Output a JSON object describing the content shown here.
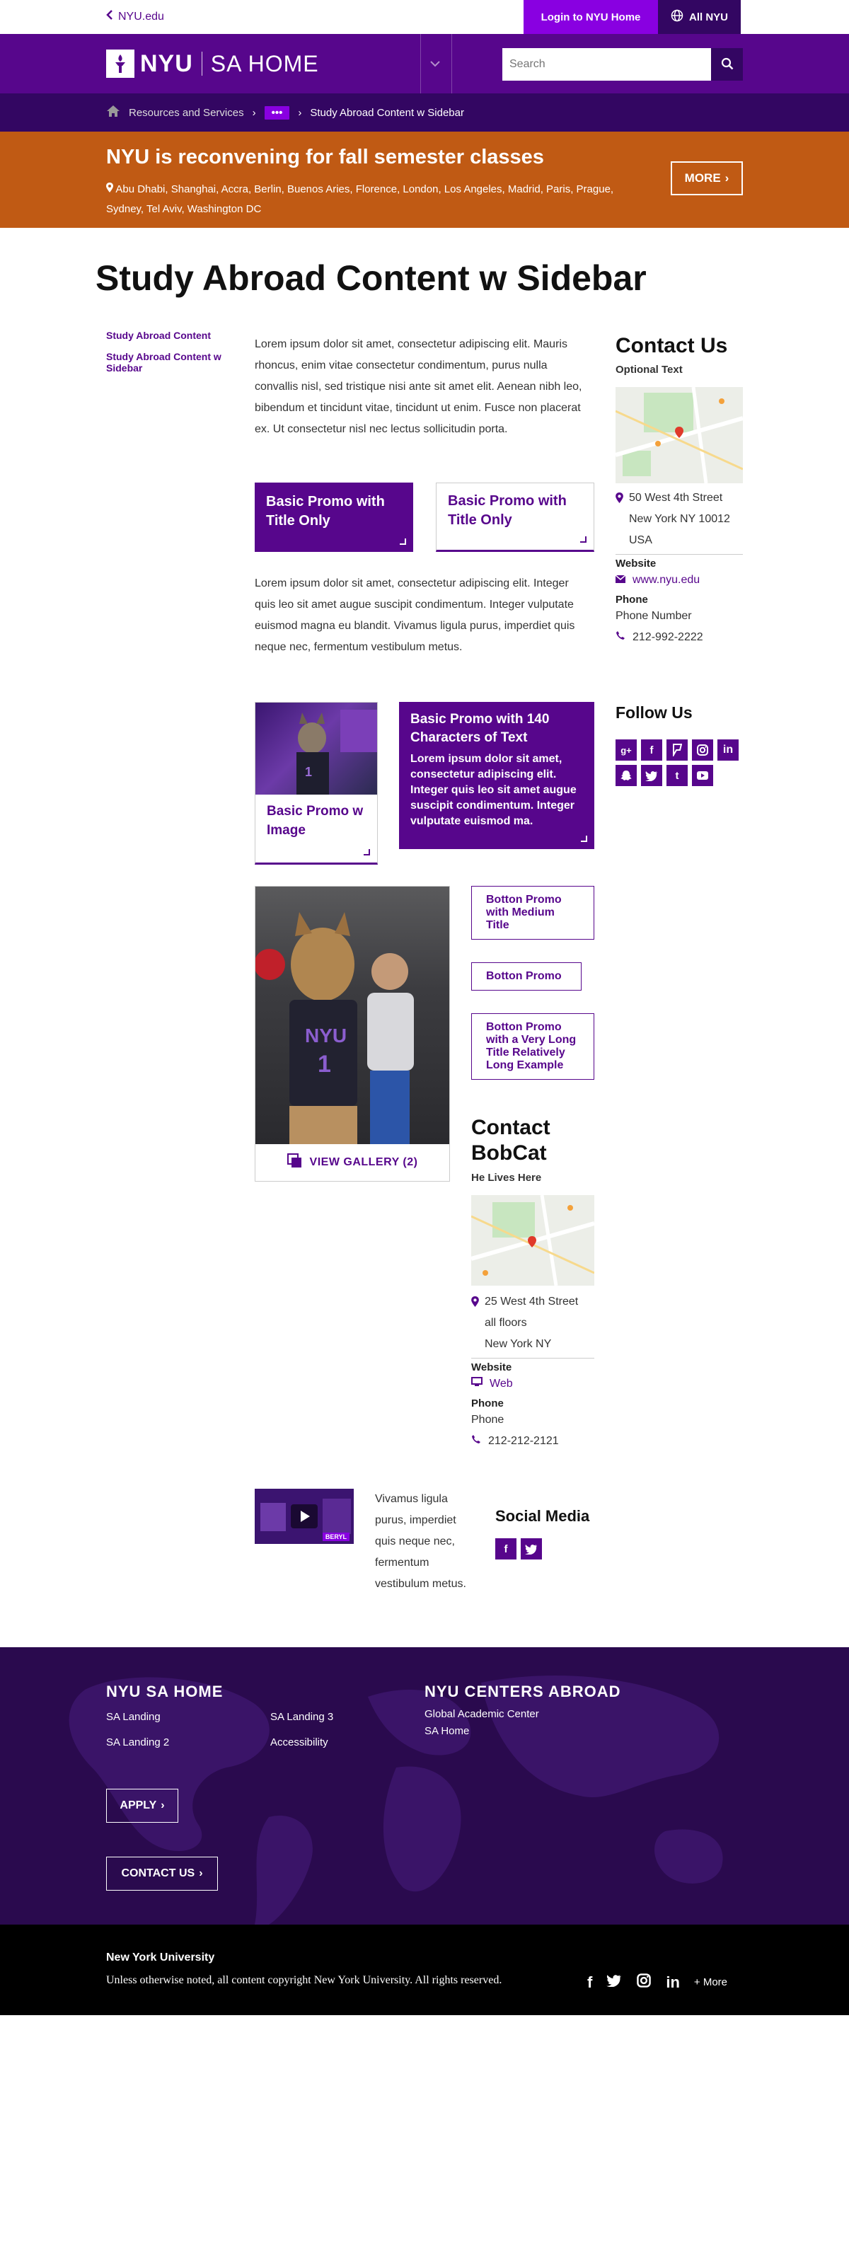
{
  "util": {
    "back_label": "NYU.edu",
    "login_label": "Login to NYU Home",
    "allnyu_label": "All NYU"
  },
  "header": {
    "logo_nyu": "NYU",
    "logo_site": "SA HOME",
    "search_placeholder": "Search"
  },
  "breadcrumb": {
    "item1": "Resources and Services",
    "more": "•••",
    "current": "Study Abroad Content w Sidebar"
  },
  "alert": {
    "title": "NYU is reconvening for fall semester classes",
    "locations": "Abu Dhabi, Shanghai, Accra, Berlin, Buenos Aries, Florence, London, Los Angeles, Madrid, Paris, Prague, Sydney, Tel Aviv, Washington DC",
    "more_label": "MORE"
  },
  "page": {
    "title": "Study Abroad Content w Sidebar"
  },
  "left_nav": [
    "Study Abroad Content",
    "Study Abroad Content w Sidebar"
  ],
  "main": {
    "para1": "Lorem ipsum dolor sit amet, consectetur adipiscing elit. Mauris rhoncus, enim vitae consectetur condimentum, purus nulla convallis nisl, sed tristique nisi ante sit amet elit. Aenean nibh leo, bibendum et tincidunt vitae, tincidunt ut enim. Fusce non placerat ex. Ut consectetur nisl nec lectus sollicitudin porta.",
    "promo_solid_title": "Basic Promo with Title Only",
    "promo_line_title": "Basic Promo with Title Only",
    "para2": "Lorem ipsum dolor sit amet, consectetur adipiscing elit. Integer quis leo sit amet augue suscipit condimentum. Integer vulputate euismod magna eu blandit. Vivamus ligula purus, imperdiet quis neque nec, fermentum vestibulum metus.",
    "promo_image_title": "Basic Promo w Image",
    "promo_140_title": "Basic Promo with 140 Characters of Text",
    "promo_140_body": "Lorem ipsum dolor sit amet, consectetur adipiscing elit. Integer quis leo sit amet augue suscipit condimentum. Integer vulputate euismod ma.",
    "gallery_label": "VIEW GALLERY (2)",
    "button1": "Botton Promo with Medium Title",
    "button2": "Botton Promo",
    "button3": "Botton Promo with a Very Long Title Relatively Long Example",
    "video_badge": "BERYL",
    "video_text": "Vivamus ligula purus, imperdiet quis neque nec, fermentum vestibulum metus."
  },
  "contact_bobcat": {
    "title": "Contact BobCat",
    "subtitle": "He Lives Here",
    "addr1": "25 West 4th Street",
    "addr2": "all floors",
    "addr3": "New York NY",
    "website_label": "Website",
    "website_link": "Web",
    "phone_label": "Phone",
    "phone_text": "Phone",
    "phone_number": "212-212-2121"
  },
  "social_media": {
    "title": "Social Media"
  },
  "contact_us": {
    "title": "Contact Us",
    "subtitle": "Optional Text",
    "addr1": "50 West 4th Street",
    "addr2": "New York NY 10012",
    "addr3": "USA",
    "website_label": "Website",
    "website_link": "www.nyu.edu",
    "phone_label": "Phone",
    "phone_text": "Phone Number",
    "phone_number": "212-992-2222"
  },
  "follow_us": {
    "title": "Follow Us",
    "icons": [
      "google-plus-icon",
      "facebook-icon",
      "foursquare-icon",
      "instagram-icon",
      "linkedin-icon",
      "snapchat-icon",
      "twitter-icon",
      "tumblr-icon",
      "youtube-icon"
    ]
  },
  "footer": {
    "col1_title": "NYU SA HOME",
    "links_a": [
      "SA Landing",
      "SA Landing 2"
    ],
    "links_b": [
      "SA Landing 3",
      "Accessibility"
    ],
    "col2_title": "NYU CENTERS ABROAD",
    "col2_links": [
      "Global Academic Center",
      "SA Home"
    ],
    "apply_label": "APPLY",
    "contact_label": "CONTACT US"
  },
  "legal": {
    "org": "New York University",
    "copyright": "Unless otherwise noted, all content copyright New York University. All rights reserved.",
    "more_label": "+ More"
  },
  "colors": {
    "purple": "#57068c",
    "violet": "#8900e1",
    "dark_purple": "#330662",
    "orange": "#c05a14"
  }
}
